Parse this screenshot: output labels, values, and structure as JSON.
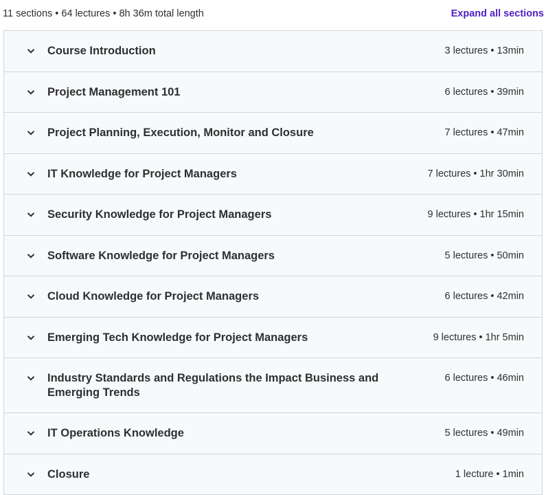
{
  "header": {
    "summary": "11 sections • 64 lectures • 8h 36m total length",
    "expand_all_label": "Expand all sections"
  },
  "colors": {
    "accent": "#5022c3",
    "row_background": "#f7f9fa",
    "border": "#d1d7dc",
    "text": "#2d2f31"
  },
  "sections": [
    {
      "title": "Course Introduction",
      "meta": "3 lectures • 13min",
      "icon": "chevron-down-icon"
    },
    {
      "title": "Project Management 101",
      "meta": "6 lectures • 39min",
      "icon": "chevron-down-icon"
    },
    {
      "title": "Project Planning, Execution, Monitor and Closure",
      "meta": "7 lectures • 47min",
      "icon": "chevron-down-icon"
    },
    {
      "title": "IT Knowledge for Project Managers",
      "meta": "7 lectures • 1hr 30min",
      "icon": "chevron-down-icon"
    },
    {
      "title": "Security Knowledge for Project Managers",
      "meta": "9 lectures • 1hr 15min",
      "icon": "chevron-down-icon"
    },
    {
      "title": "Software Knowledge for Project Managers",
      "meta": "5 lectures • 50min",
      "icon": "chevron-down-icon"
    },
    {
      "title": "Cloud Knowledge for Project Managers",
      "meta": "6 lectures • 42min",
      "icon": "chevron-down-icon"
    },
    {
      "title": "Emerging Tech Knowledge for Project Managers",
      "meta": "9 lectures • 1hr 5min",
      "icon": "chevron-down-icon"
    },
    {
      "title": "Industry Standards and Regulations the Impact Business and Emerging Trends",
      "meta": "6 lectures • 46min",
      "icon": "chevron-down-icon"
    },
    {
      "title": "IT Operations Knowledge",
      "meta": "5 lectures • 49min",
      "icon": "chevron-down-icon"
    },
    {
      "title": "Closure",
      "meta": "1 lecture • 1min",
      "icon": "chevron-down-icon"
    }
  ]
}
